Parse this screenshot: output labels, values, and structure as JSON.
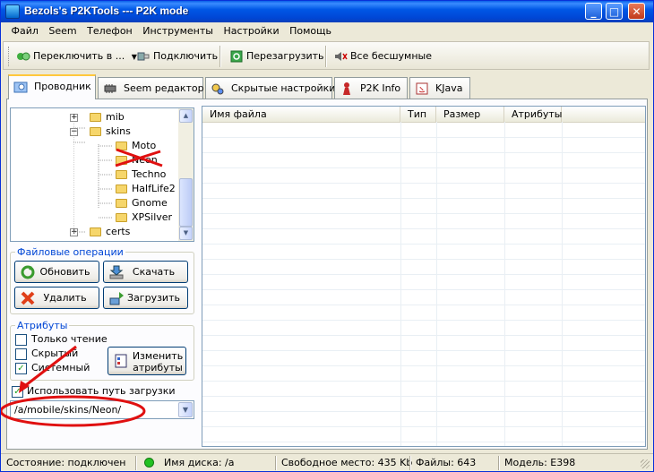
{
  "window": {
    "title": "Bezols's P2KTools --- P2K mode"
  },
  "menu": [
    "Файл",
    "Seem",
    "Телефон",
    "Инструменты",
    "Настройки",
    "Помощь"
  ],
  "toolbar": {
    "switch_label": "Переключить в ...",
    "connect_label": "Подключить",
    "reboot_label": "Перезагрузить",
    "silent_label": "Все бесшумные"
  },
  "tabs": [
    "Проводник",
    "Seem редактор",
    "Скрытые настройки",
    "P2K Info",
    "KJava"
  ],
  "tree": {
    "items": [
      {
        "label": "mib"
      },
      {
        "label": "skins"
      },
      {
        "label": "Moto"
      },
      {
        "label": "Neon"
      },
      {
        "label": "Techno"
      },
      {
        "label": "HalfLife2"
      },
      {
        "label": "Gnome"
      },
      {
        "label": "XPSilver"
      },
      {
        "label": "certs"
      }
    ]
  },
  "file_ops": {
    "legend": "Файловые операции",
    "refresh": "Обновить",
    "download": "Скачать",
    "delete": "Удалить",
    "upload": "Загрузить"
  },
  "attributes": {
    "legend": "Атрибуты",
    "read_only": "Только чтение",
    "hidden": "Скрытый",
    "system": "Системный",
    "change_line1": "Изменить",
    "change_line2": "атрибуты"
  },
  "upload_path": {
    "use_label": "Использовать путь загрузки",
    "value": "/a/mobile/skins/Neon/"
  },
  "file_list": {
    "columns": [
      "Имя файла",
      "Тип",
      "Размер",
      "Атрибуты"
    ]
  },
  "status": {
    "state": "Состояние: подключен",
    "disk": "Имя диска: /a",
    "free": "Свободное место: 435 Kb",
    "files": "Файлы: 643",
    "model": "Модель: E398"
  },
  "colors": {
    "accent": "#0046d5",
    "annotation": "#e01010",
    "status_dot": "#22c122"
  }
}
